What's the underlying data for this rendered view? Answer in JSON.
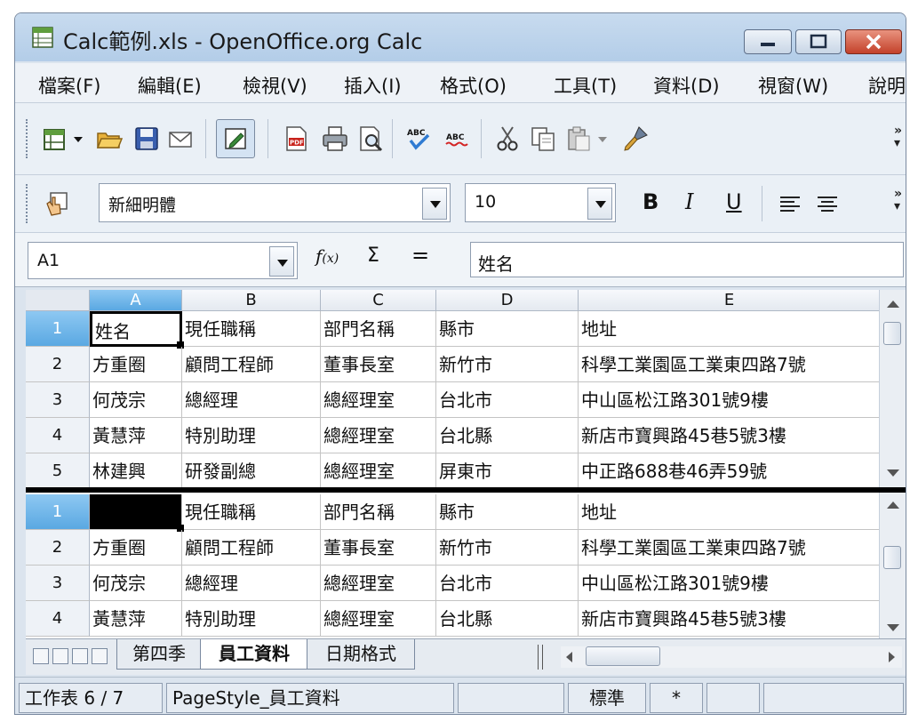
{
  "window": {
    "title": "Calc範例.xls - OpenOffice.org Calc"
  },
  "menu": [
    "檔案(F)",
    "編輯(E)",
    "檢視(V)",
    "插入(I)",
    "格式(O)",
    "工具(T)",
    "資料(D)",
    "視窗(W)",
    "說明"
  ],
  "toolbar_format": {
    "font_name": "新細明體",
    "font_size": "10",
    "bold": "B",
    "italic": "I",
    "underline": "U"
  },
  "formula_bar": {
    "name_box": "A1",
    "content": "姓名",
    "sum_symbol": "Σ",
    "equals_symbol": "="
  },
  "grid": {
    "columns": [
      "A",
      "B",
      "C",
      "D",
      "E"
    ],
    "rows_top": [
      {
        "num": "1",
        "cells": [
          "姓名",
          "現任職稱",
          "部門名稱",
          "縣市",
          "地址"
        ]
      },
      {
        "num": "2",
        "cells": [
          "方重圈",
          "顧問工程師",
          "董事長室",
          "新竹市",
          "科學工業園區工業東四路7號"
        ]
      },
      {
        "num": "3",
        "cells": [
          "何茂宗",
          "總經理",
          "總經理室",
          "台北市",
          "中山區松江路301號9樓"
        ]
      },
      {
        "num": "4",
        "cells": [
          "黃慧萍",
          "特別助理",
          "總經理室",
          "台北縣",
          "新店市寶興路45巷5號3樓"
        ]
      },
      {
        "num": "5",
        "cells": [
          "林建興",
          "研發副總",
          "總經理室",
          "屏東市",
          "中正路688巷46弄59號"
        ]
      }
    ],
    "rows_bottom": [
      {
        "num": "1",
        "cells": [
          "",
          "現任職稱",
          "部門名稱",
          "縣市",
          "地址"
        ]
      },
      {
        "num": "2",
        "cells": [
          "方重圈",
          "顧問工程師",
          "董事長室",
          "新竹市",
          "科學工業園區工業東四路7號"
        ]
      },
      {
        "num": "3",
        "cells": [
          "何茂宗",
          "總經理",
          "總經理室",
          "台北市",
          "中山區松江路301號9樓"
        ]
      },
      {
        "num": "4",
        "cells": [
          "黃慧萍",
          "特別助理",
          "總經理室",
          "台北縣",
          "新店市寶興路45巷5號3樓"
        ]
      }
    ]
  },
  "sheet_tabs": [
    "第四季",
    "員工資料",
    "日期格式"
  ],
  "status": {
    "sheet": "工作表 6 / 7",
    "page_style": "PageStyle_員工資料",
    "mode": "標準",
    "modified": "*"
  }
}
